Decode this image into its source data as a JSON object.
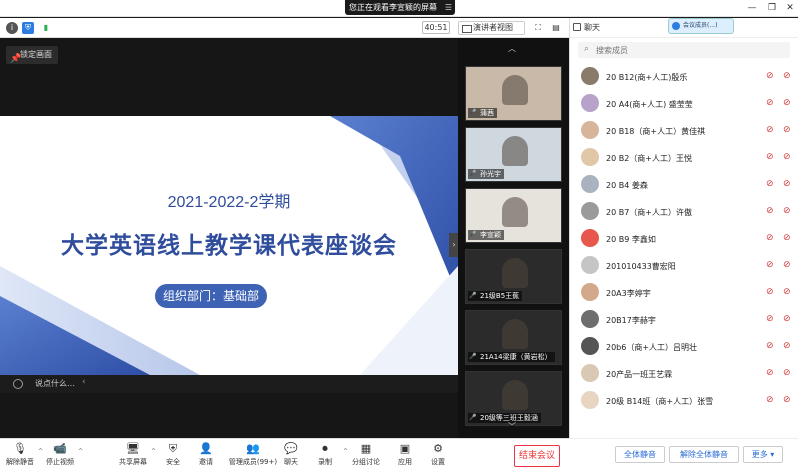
{
  "share_banner": {
    "text": "您正在观看李宣颖的屏幕",
    "menu_icon": "menu-icon"
  },
  "window_controls": [
    "minimize",
    "restore",
    "close"
  ],
  "top_toolbar": {
    "timer": "40:51",
    "view_button": "演讲者视图"
  },
  "stage": {
    "lock_button": "锁定画面",
    "slide": {
      "line1": "2021-2022-2学期",
      "line2": "大学英语线上教学课代表座谈会",
      "pill": "组织部门：基础部"
    },
    "chat_placeholder": "说点什么…"
  },
  "gallery": {
    "thumbs": [
      {
        "name": "蒲茜",
        "color": "#c8b9a8"
      },
      {
        "name": "孙光宇",
        "color": "#cfd7df"
      },
      {
        "name": "李宣颖",
        "color": "#e6e3dc"
      },
      {
        "name": "21级B5王蕉",
        "color": "#2b2b2b"
      },
      {
        "name": "21A14梁康（黄岩松）",
        "color": "#2b2b2b"
      },
      {
        "name": "20级等三班王毅涵",
        "color": "#2b2b2b"
      }
    ]
  },
  "panel": {
    "title": "聊天",
    "popup": "会议成员(...)",
    "search_placeholder": "搜索成员",
    "members": [
      {
        "name": "20  B12(商+人工)殷乐",
        "color": "#8a7a6a"
      },
      {
        "name": "20 A4(商+人工) 盛莹莹",
        "color": "#b7a2c9"
      },
      {
        "name": "20 B18（商+人工）黄佳祺",
        "color": "#d7b59a"
      },
      {
        "name": "20 B2（商+人工）王悦",
        "color": "#e0c7a8"
      },
      {
        "name": "20 B4 姜森",
        "color": "#a9b3bf"
      },
      {
        "name": "20 B7（商+人工）许傲",
        "color": "#9a9a9a"
      },
      {
        "name": "20 B9 李鑫如",
        "color": "#e8574c"
      },
      {
        "name": "201010433曹宏阳",
        "color": "#c5c5c5"
      },
      {
        "name": "20A3李婷宇",
        "color": "#d2a98c"
      },
      {
        "name": "20B17李赫宇",
        "color": "#6e6e6e"
      },
      {
        "name": "20b6（商+人工）吕明壮",
        "color": "#555555"
      },
      {
        "name": "20产品一班王艺霖",
        "color": "#d9c8b4"
      },
      {
        "name": "20级 B14班（商+人工）张雪",
        "color": "#e7d5c2"
      }
    ],
    "buttons": {
      "mute_all": "全体静音",
      "unmute_all": "解除全体静音",
      "more": "更多 ▾"
    }
  },
  "bottombar": {
    "items": [
      {
        "label": "解除静音",
        "icon": "mic-muted-icon"
      },
      {
        "label": "停止视频",
        "icon": "camera-icon"
      },
      {
        "label": "共享屏幕",
        "icon": "share-screen-icon"
      },
      {
        "label": "安全",
        "icon": "shield-icon"
      },
      {
        "label": "邀请",
        "icon": "invite-icon"
      },
      {
        "label": "管理成员(99+)",
        "icon": "members-icon"
      },
      {
        "label": "聊天",
        "icon": "chat-icon"
      },
      {
        "label": "录制",
        "icon": "record-icon"
      },
      {
        "label": "分组讨论",
        "icon": "breakout-icon"
      },
      {
        "label": "应用",
        "icon": "apps-icon"
      },
      {
        "label": "设置",
        "icon": "settings-icon"
      }
    ],
    "end_meeting": "结束会议"
  }
}
